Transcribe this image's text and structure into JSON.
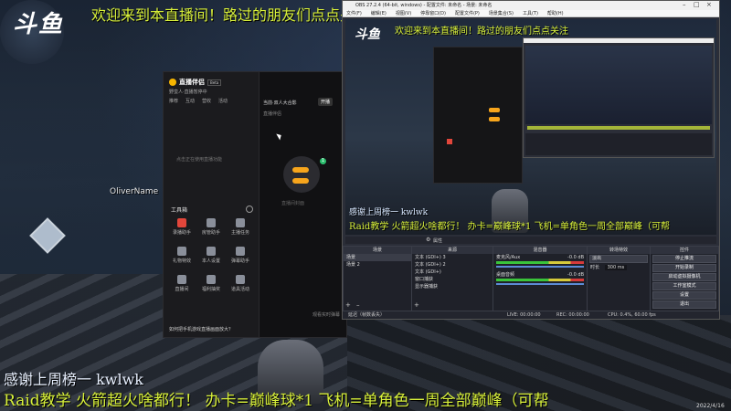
{
  "stream": {
    "logo": "斗鱼",
    "banner_top": "欢迎来到本直播间！路过的朋友们点点关注",
    "thanks_line": "感谢上周榜一 kwlwk",
    "promo_line": "Raid教学 火箭超火啥都行！ 办卡=巅峰球*1 飞机=单角色一周全部巅峰（可帮",
    "player_tag": "OliverName",
    "timestamp": "2022/4/16"
  },
  "companion_app": {
    "title": "直播伴侣",
    "title_badge": "Beta",
    "header_text": "野蛮人·直播暂停中",
    "live_button": "开播",
    "tabs": [
      "推荐",
      "互动",
      "营收",
      "活动"
    ],
    "search_placeholder": "当前·双人大合影",
    "status_text": "点击正在使用直播功能",
    "section_title": "工具箱",
    "tools": [
      {
        "label": "录播助手",
        "color": "#e2463b"
      },
      {
        "label": "房管助手",
        "color": "#8a8f9a"
      },
      {
        "label": "主播任务",
        "color": "#8a8f9a"
      },
      {
        "label": "礼物特效",
        "color": "#8a8f9a"
      },
      {
        "label": "本人设置",
        "color": "#8a8f9a"
      },
      {
        "label": "弹幕助手",
        "color": "#8a8f9a"
      },
      {
        "label": "直播间",
        "color": "#8a8f9a"
      },
      {
        "label": "福利抽奖",
        "color": "#8a8f9a"
      },
      {
        "label": "道具活动",
        "color": "#8a8f9a"
      }
    ],
    "footer_text": "如何把手机游戏直播画面放大？",
    "preview_caption": "直播间封面",
    "scene_badge": "1",
    "right_panel_label": "直播伴侣",
    "chat_label": "观看实时弹幕"
  },
  "obs": {
    "window_title": "OBS 27.2.4 (64-bit, windows) - 配置文件: 未命名 - 场景: 未命名",
    "menu": [
      "文件(F)",
      "编辑(E)",
      "视图(V)",
      "停靠窗口(D)",
      "配置文件(P)",
      "场景集合(S)",
      "工具(T)",
      "帮助(H)"
    ],
    "preview_overlay": "欢迎来到本直播间！路过的朋友们点点关注",
    "preview_thanks": "感谢上周榜一 kwlwk",
    "preview_promo": "Raid教学 火箭超火啥都行！ 办卡=巅峰球*1 飞机=单角色一周全部巅峰（可帮",
    "source_bar": "属性",
    "docks": {
      "scenes": {
        "title": "场景",
        "items": [
          "场景",
          "场景 2"
        ]
      },
      "sources": {
        "title": "来源",
        "items": [
          "文本 (GDI+) 3",
          "文本 (GDI+) 2",
          "文本 (GDI+)",
          "窗口捕获",
          "显示器捕获"
        ]
      },
      "mixer": {
        "title": "混音器",
        "channels": [
          {
            "name": "麦克风/Aux",
            "level": "-0.0 dB"
          },
          {
            "name": "桌面音频",
            "level": "-0.0 dB"
          }
        ]
      },
      "transitions": {
        "title": "转场特效",
        "type": "淡出",
        "duration_label": "时长",
        "duration": "300 ms"
      },
      "controls": {
        "title": "控件",
        "buttons": [
          "停止推流",
          "开始录制",
          "启动虚拟摄像机",
          "工作室模式",
          "设置",
          "退出"
        ]
      }
    },
    "status": {
      "live": "LIVE: 00:00:00",
      "rec": "REC: 00:00:00",
      "cpu": "CPU: 0.4%, 60.00 fps",
      "dropped": "延迟（帧数丢失）"
    }
  }
}
